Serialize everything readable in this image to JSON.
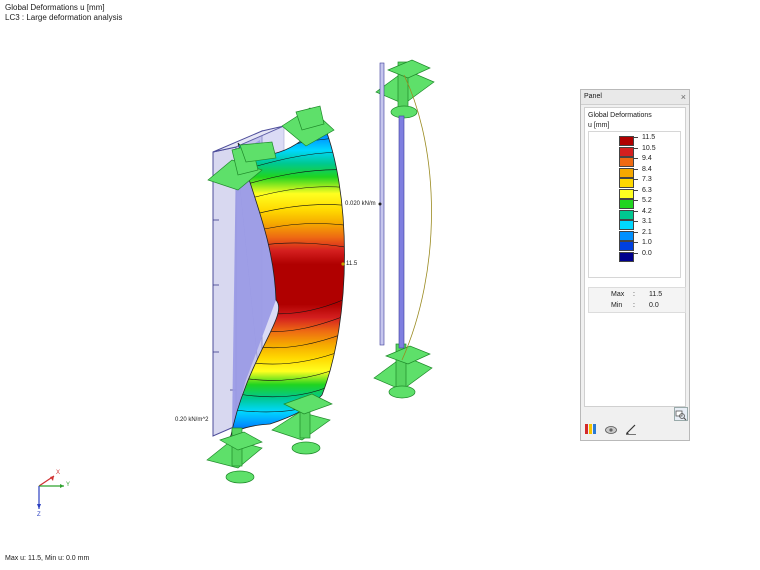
{
  "header": {
    "title": "Global Deformations u [mm]",
    "subtitle": "LC3 : Large deformation analysis"
  },
  "labels": {
    "line_load": "0.020 kN/m",
    "area_load": "0.20 kN/m^2",
    "max_marker": "11.5"
  },
  "axes": {
    "x": "X",
    "y": "Y",
    "z": "Z"
  },
  "panel": {
    "title": "Panel",
    "close": "×",
    "result_title": "Global Deformations",
    "unit": "u [mm]",
    "scale": [
      {
        "value": "11.5",
        "color": "#b00000"
      },
      {
        "value": "10.5",
        "color": "#d41f1f"
      },
      {
        "value": "9.4",
        "color": "#ee6a13"
      },
      {
        "value": "8.4",
        "color": "#f5a800"
      },
      {
        "value": "7.3",
        "color": "#ffd800"
      },
      {
        "value": "6.3",
        "color": "#ffff20"
      },
      {
        "value": "5.2",
        "color": "#20d420"
      },
      {
        "value": "4.2",
        "color": "#00c890"
      },
      {
        "value": "3.1",
        "color": "#00d8ff"
      },
      {
        "value": "2.1",
        "color": "#0090ff"
      },
      {
        "value": "1.0",
        "color": "#0040e0"
      },
      {
        "value": "0.0",
        "color": "#00008c"
      }
    ],
    "max_label": "Max",
    "min_label": "Min",
    "sep": ":",
    "max_value": "11.5",
    "min_value": "0.0",
    "tabs": [
      "color-scale-tab",
      "view-tab",
      "settings-tab"
    ]
  },
  "status": {
    "text": "Max u: 11.5, Min u: 0.0 mm"
  }
}
